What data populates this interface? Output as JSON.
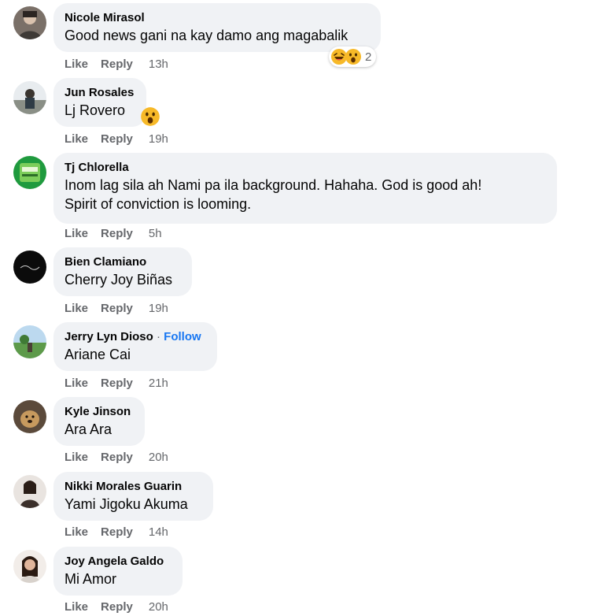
{
  "comments": [
    {
      "author": "Nicole Mirasol",
      "text": "Good news gani na kay damo ang magabalik",
      "like": "Like",
      "reply": "Reply",
      "time": "13h",
      "reactions_count": "2"
    },
    {
      "author": "Jun Rosales",
      "text": "Lj Rovero",
      "like": "Like",
      "reply": "Reply",
      "time": "19h"
    },
    {
      "author": "Tj Chlorella",
      "text_line1": "Inom lag sila ah Nami pa ila background. Hahaha. God is good ah!",
      "text_line2": "Spirit of conviction is looming.",
      "like": "Like",
      "reply": "Reply",
      "time": "5h"
    },
    {
      "author": "Bien Clamiano",
      "text": "Cherry Joy Biñas",
      "like": "Like",
      "reply": "Reply",
      "time": "19h"
    },
    {
      "author": "Jerry Lyn Dioso",
      "separator": "·",
      "follow": "Follow",
      "text": "Ariane Cai",
      "like": "Like",
      "reply": "Reply",
      "time": "21h"
    },
    {
      "author": "Kyle Jinson",
      "text": "Ara Ara",
      "like": "Like",
      "reply": "Reply",
      "time": "20h"
    },
    {
      "author": "Nikki Morales Guarin",
      "text": "Yami Jigoku Akuma",
      "like": "Like",
      "reply": "Reply",
      "time": "14h"
    },
    {
      "author": "Joy Angela Galdo",
      "text": "Mi Amor",
      "like": "Like",
      "reply": "Reply",
      "time": "20h"
    }
  ],
  "icons": {
    "haha": "haha-reaction-icon",
    "wow": "wow-reaction-icon"
  }
}
